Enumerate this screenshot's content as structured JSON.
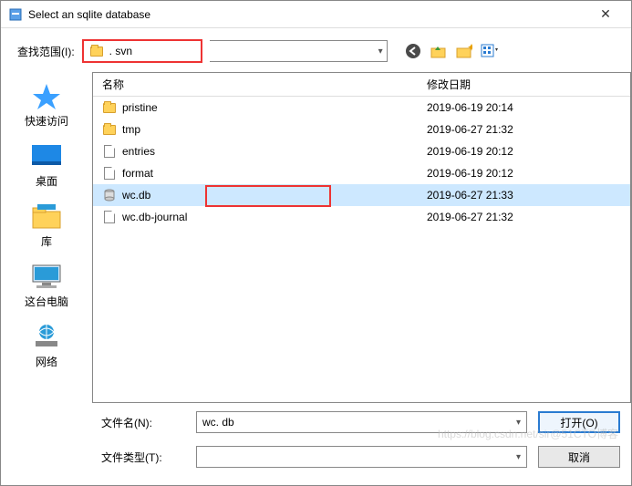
{
  "title": "Select an sqlite database",
  "lookin_label": "查找范围(I):",
  "lookin_folder": ". svn",
  "columns": {
    "name": "名称",
    "date": "修改日期"
  },
  "sidebar": [
    {
      "label": "快速访问",
      "icon": "star"
    },
    {
      "label": "桌面",
      "icon": "desktop"
    },
    {
      "label": "库",
      "icon": "library"
    },
    {
      "label": "这台电脑",
      "icon": "pc"
    },
    {
      "label": "网络",
      "icon": "network"
    }
  ],
  "files": [
    {
      "name": "pristine",
      "type": "folder",
      "date": "2019-06-19 20:14"
    },
    {
      "name": "tmp",
      "type": "folder",
      "date": "2019-06-27 21:32"
    },
    {
      "name": "entries",
      "type": "file",
      "date": "2019-06-19 20:12"
    },
    {
      "name": "format",
      "type": "file",
      "date": "2019-06-19 20:12"
    },
    {
      "name": "wc.db",
      "type": "db",
      "date": "2019-06-27 21:33",
      "selected": true
    },
    {
      "name": "wc.db-journal",
      "type": "file",
      "date": "2019-06-27 21:32"
    }
  ],
  "filename_label": "文件名(N):",
  "filetype_label": "文件类型(T):",
  "filename_value": "wc. db",
  "filetype_value": "",
  "open_btn": "打开(O)",
  "cancel_btn": "取消",
  "watermark": "https://blog.csdn.net/sir@51CTO博客"
}
